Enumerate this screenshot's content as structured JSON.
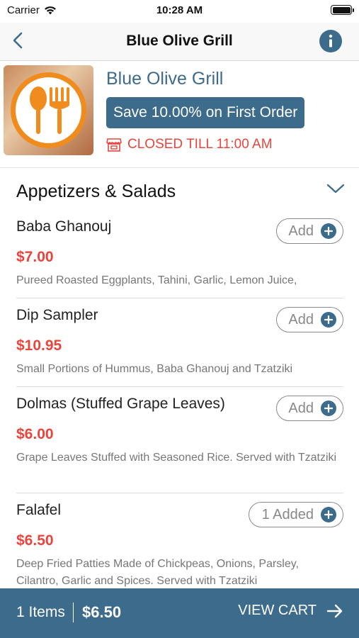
{
  "status_bar": {
    "carrier": "Carrier",
    "time": "10:28 AM"
  },
  "nav": {
    "title": "Blue Olive Grill"
  },
  "restaurant": {
    "name": "Blue Olive Grill",
    "promo": "Save 10.00% on First Order",
    "status": "CLOSED TILL 11:00 AM"
  },
  "section": {
    "title": "Appetizers & Salads"
  },
  "items": [
    {
      "name": "Baba Ghanouj",
      "price": "$7.00",
      "description": "Pureed Roasted Eggplants, Tahini, Garlic, Lemon Juice,",
      "button": "Add"
    },
    {
      "name": "Dip Sampler",
      "price": "$10.95",
      "description": "Small Portions of Hummus, Baba Ghanouj and Tzatziki",
      "button": "Add"
    },
    {
      "name": "Dolmas (Stuffed Grape Leaves)",
      "price": "$6.00",
      "description": "Grape Leaves Stuffed with Seasoned Rice. Served with Tzatziki",
      "button": "Add"
    },
    {
      "name": "Falafel",
      "price": "$6.50",
      "description": "Deep Fried Patties Made of Chickpeas, Onions, Parsley, Cilantro, Garlic and Spices. Served with Tzatziki",
      "button": "1 Added"
    }
  ],
  "cart": {
    "count": "1 Items",
    "total": "$6.50",
    "action": "VIEW CART"
  },
  "colors": {
    "accent": "#3d6b8c",
    "price": "#e8453c",
    "logo_ring": "#f08c1e"
  },
  "icons": [
    "wifi-icon",
    "battery-icon",
    "back-chevron-icon",
    "info-icon",
    "fork-spoon-logo-icon",
    "store-closed-icon",
    "chevron-down-icon",
    "plus-circle-icon",
    "arrow-right-icon"
  ]
}
